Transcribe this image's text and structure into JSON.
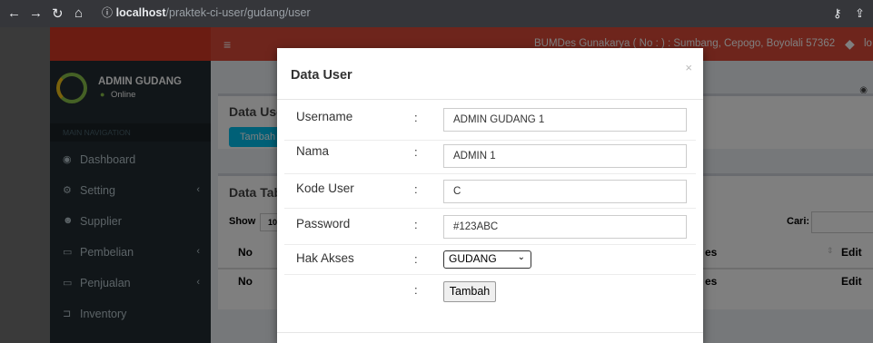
{
  "browser": {
    "url_host": "localhost",
    "url_path": "/praktek-ci-user/gudang/user"
  },
  "topnav": {
    "header_text": "BUMDes Gunakarya ( No : ) : Sumbang, Cepogo, Boyolali 57362",
    "user_fragment": "lo"
  },
  "sidebar": {
    "user_name": "ADMIN GUDANG",
    "status": "Online",
    "section_label": "MAIN NAVIGATION",
    "items": [
      {
        "label": "Dashboard",
        "icon": "dashboard-icon",
        "glyph": "◉",
        "has_children": false
      },
      {
        "label": "Setting",
        "icon": "gears-icon",
        "glyph": "⚙",
        "has_children": true
      },
      {
        "label": "Supplier",
        "icon": "users-icon",
        "glyph": "☻",
        "has_children": false
      },
      {
        "label": "Pembelian",
        "icon": "laptop-icon",
        "glyph": "▭",
        "has_children": true
      },
      {
        "label": "Penjualan",
        "icon": "laptop-icon",
        "glyph": "▭",
        "has_children": true
      },
      {
        "label": "Inventory",
        "icon": "cart-icon",
        "glyph": "⊐",
        "has_children": false
      }
    ]
  },
  "content": {
    "box1_title": "Data Use",
    "box1_button": "Tambah D",
    "box2_title": "Data Tab",
    "show_label": "Show",
    "show_value": "10",
    "search_label": "Cari:",
    "col_no": "No",
    "col_es": "es",
    "col_edit": "Edit"
  },
  "modal": {
    "title": "Data User",
    "close_glyph": "×",
    "fields": [
      {
        "label": "Username",
        "value": "ADMIN GUDANG 1"
      },
      {
        "label": "Nama",
        "value": "ADMIN 1"
      },
      {
        "label": "Kode User",
        "value": "C"
      },
      {
        "label": "Password",
        "value": "#123ABC"
      }
    ],
    "hak_akses_label": "Hak Akses",
    "hak_akses_value": "GUDANG",
    "colon": ":",
    "submit_label": "Tambah"
  },
  "colors": {
    "header_red": "#dd4b39",
    "sidebar_dark": "#222d32",
    "button_teal": "#00c0ef"
  }
}
